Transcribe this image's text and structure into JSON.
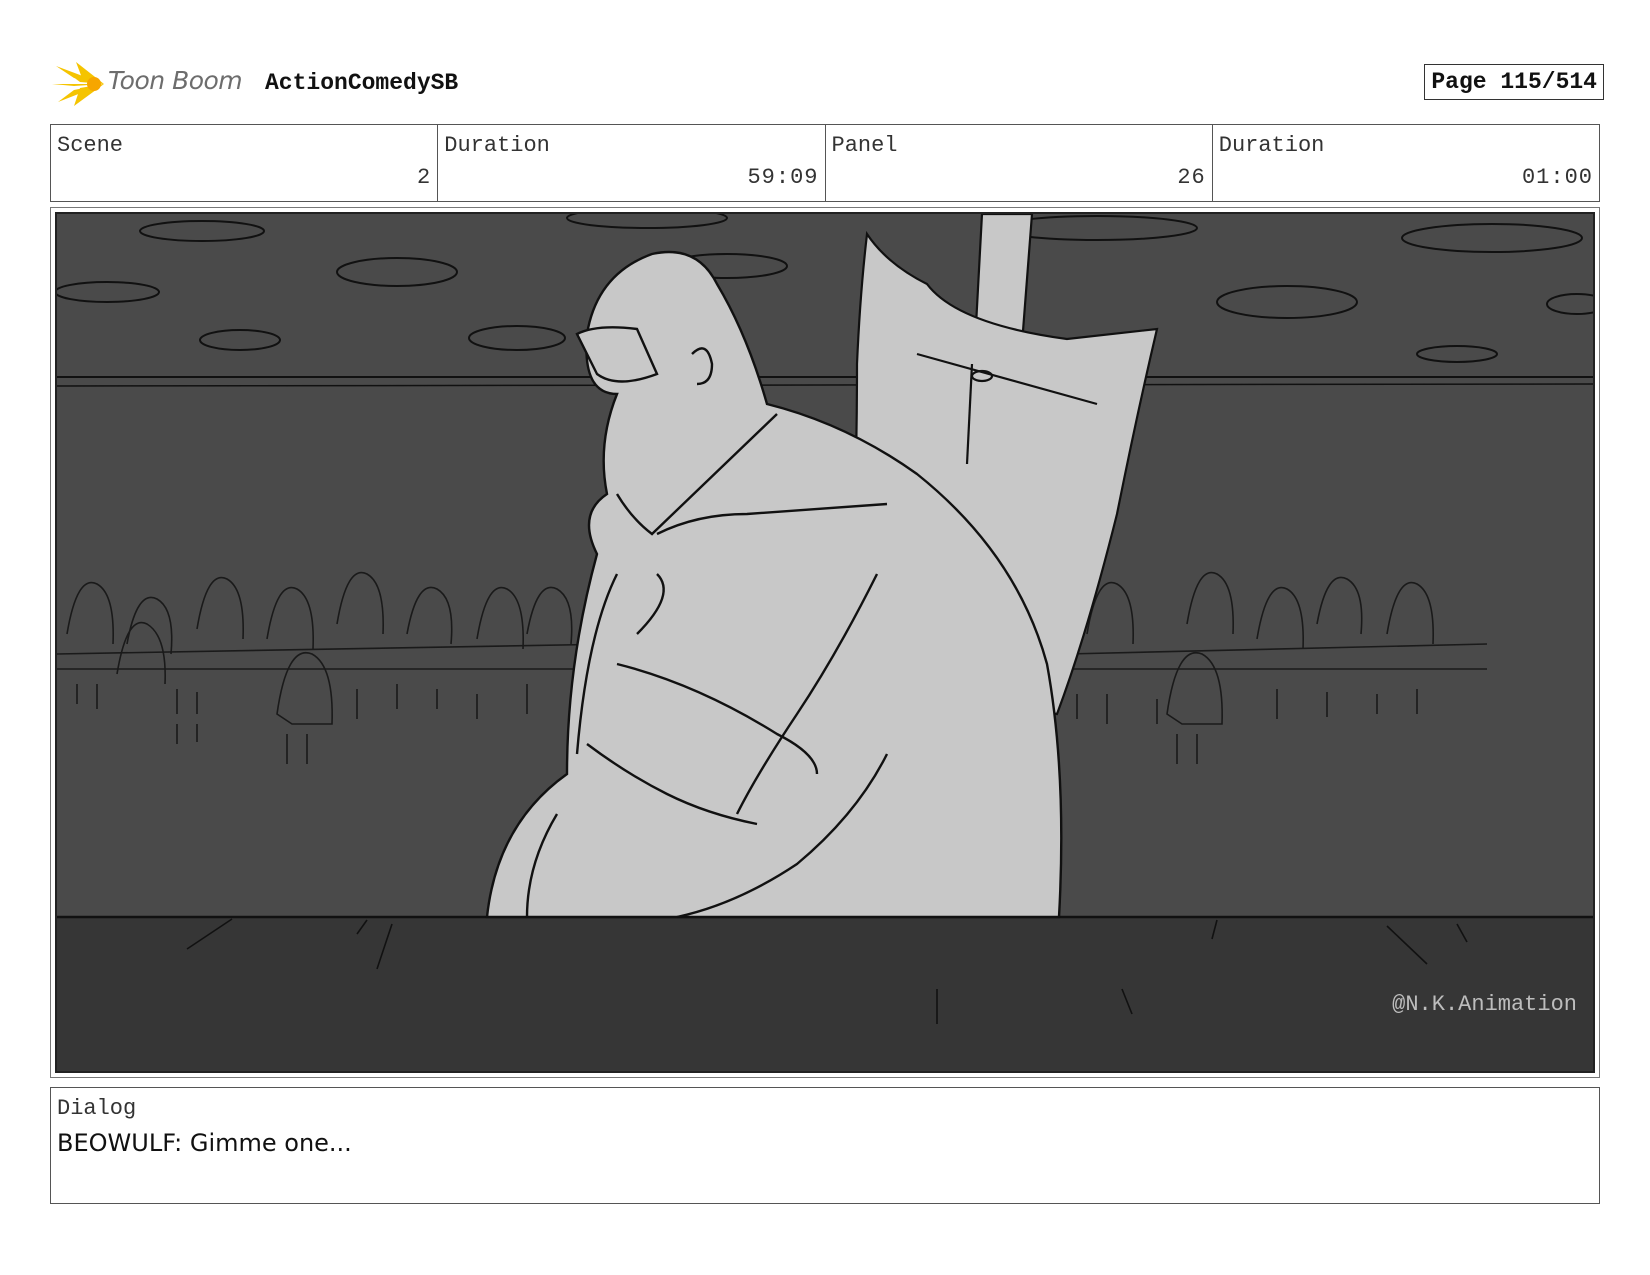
{
  "header": {
    "logo_text": "Toon Boom",
    "project_title": "ActionComedySB",
    "page_label": "Page 115/514"
  },
  "info": {
    "scene_label": "Scene",
    "scene_value": "2",
    "scene_duration_label": "Duration",
    "scene_duration_value": "59:09",
    "panel_label": "Panel",
    "panel_value": "26",
    "panel_duration_label": "Duration",
    "panel_duration_value": "01:00"
  },
  "panel": {
    "watermark": "@N.K.Animation"
  },
  "dialog": {
    "label": "Dialog",
    "text": "BEOWULF: Gimme one..."
  },
  "colors": {
    "logo_yellow": "#f5c400",
    "sky_gray": "#4a4a4a",
    "floor_gray": "#363636",
    "character_fill": "#c8c8c8"
  }
}
